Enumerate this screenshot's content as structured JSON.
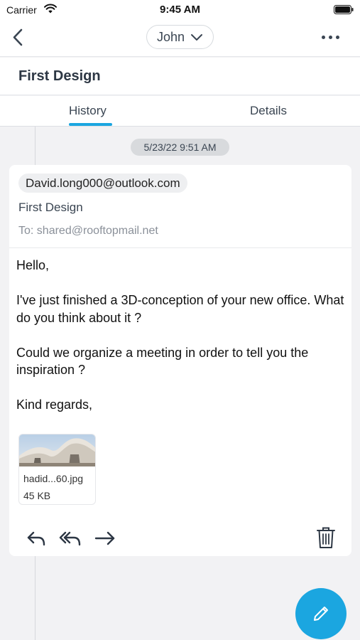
{
  "status_bar": {
    "carrier": "Carrier",
    "time": "9:45 AM",
    "icons": [
      "wifi-icon",
      "battery-icon"
    ]
  },
  "nav": {
    "back_icon": "chevron-left-icon",
    "contact_name": "John",
    "contact_dropdown_icon": "chevron-down-icon",
    "more_icon": "more-horizontal-icon"
  },
  "conversation": {
    "subject": "First Design"
  },
  "tabs": [
    {
      "label": "History",
      "active": true
    },
    {
      "label": "Details",
      "active": false
    }
  ],
  "message": {
    "date": "5/23/22 9:51 AM",
    "sender": "David.long000@outlook.com",
    "subject": "First Design",
    "to": "To: shared@rooftopmail.net",
    "body": [
      "Hello,",
      "I've just finished a 3D-conception of your new office. What do you think about it ?",
      "Could we organize a meeting in order to tell you the inspiration ?",
      "Kind regards,"
    ],
    "attachment": {
      "filename": "hadid...60.jpg",
      "size": "45 KB"
    },
    "actions": [
      "reply-icon",
      "reply-all-icon",
      "forward-icon",
      "trash-icon"
    ]
  },
  "fab": {
    "icon": "pencil-icon"
  },
  "colors": {
    "accent": "#1ba6e0",
    "background": "#f2f2f4",
    "card": "#ffffff"
  }
}
